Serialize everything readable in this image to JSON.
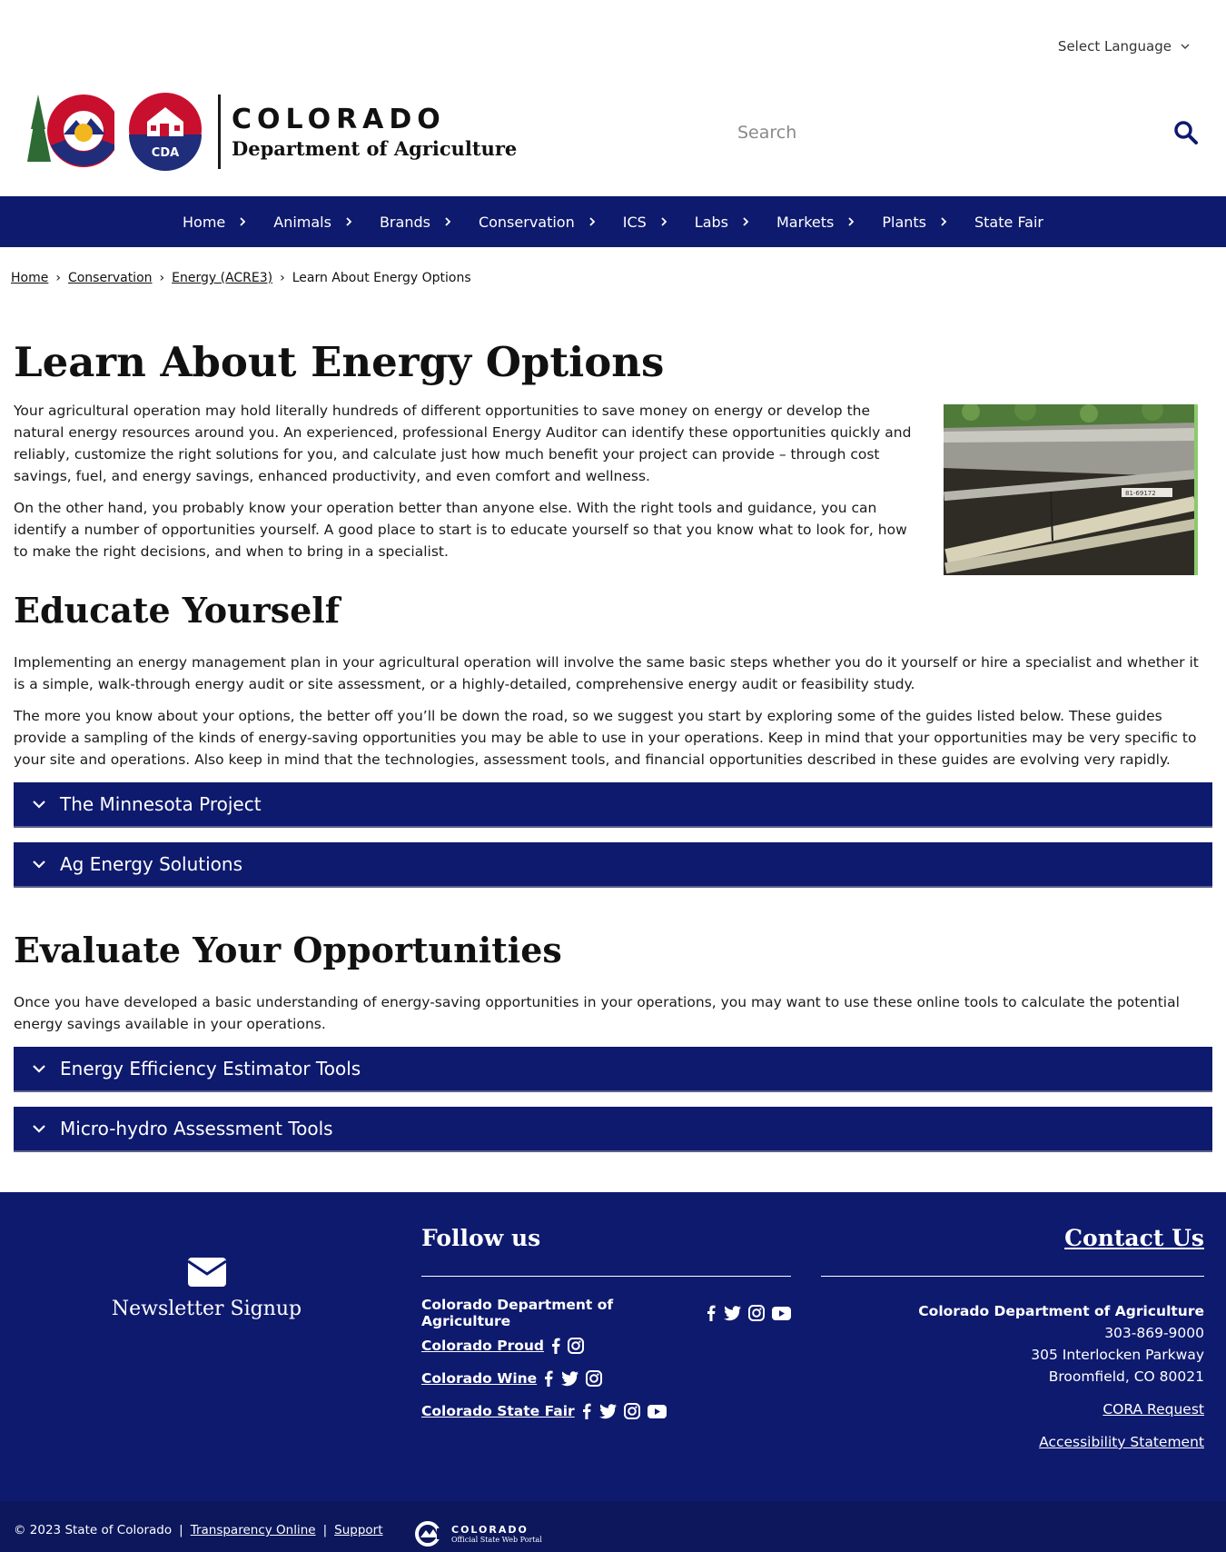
{
  "language_select": {
    "label": "Select Language"
  },
  "logo": {
    "badge_text": "CDA",
    "title": "COLORADO",
    "subtitle": "Department of Agriculture"
  },
  "search": {
    "placeholder": "Search"
  },
  "nav": {
    "items": [
      {
        "label": "Home"
      },
      {
        "label": "Animals"
      },
      {
        "label": "Brands"
      },
      {
        "label": "Conservation"
      },
      {
        "label": "ICS"
      },
      {
        "label": "Labs"
      },
      {
        "label": "Markets"
      },
      {
        "label": "Plants"
      },
      {
        "label": "State Fair"
      }
    ]
  },
  "breadcrumb": {
    "items": [
      {
        "label": "Home"
      },
      {
        "label": "Conservation"
      },
      {
        "label": "Energy (ACRE3)"
      }
    ],
    "current": "Learn About Energy Options"
  },
  "main": {
    "title": "Learn About Energy Options",
    "intro": [
      "Your agricultural operation may hold literally hundreds of different opportunities to save money on energy or develop the natural energy resources around you. An experienced, professional Energy Auditor can identify these opportunities quickly and reliably, customize the right solutions for you, and calculate just how much benefit your project can provide – through cost savings, fuel, and energy savings, enhanced productivity, and even comfort and wellness.",
      "On the other hand, you probably know your operation better than anyone else. With the right tools and guidance, you can identify a number of opportunities yourself. A good place to start is to educate yourself so that you know what to look for, how to make the right decisions, and when to bring in a specialist."
    ],
    "photo_label": "81-69172",
    "educate": {
      "heading": "Educate Yourself",
      "paragraphs": [
        "Implementing an energy management plan in your agricultural operation will involve the same basic steps whether you do it yourself or hire a specialist and whether it is a simple, walk-through energy audit or site assessment, or a highly-detailed, comprehensive energy audit or feasibility study.",
        "The more you know about your options, the better off you’ll be down the road, so we suggest you start by exploring some of the guides listed below. These guides provide a sampling of the kinds of energy-saving opportunities you may be able to use in your operations. Keep in mind that your opportunities may be very specific to your site and operations. Also keep in mind that the technologies, assessment tools, and financial opportunities described in these guides are evolving very rapidly."
      ],
      "accordions": [
        {
          "label": "The Minnesota Project"
        },
        {
          "label": "Ag Energy Solutions"
        }
      ]
    },
    "evaluate": {
      "heading": "Evaluate Your Opportunities",
      "paragraph": "Once you have developed a basic understanding of energy-saving opportunities in your operations, you may want to use these online tools to calculate the potential energy savings available in your operations.",
      "accordions": [
        {
          "label": "Energy Efficiency Estimator Tools"
        },
        {
          "label": "Micro-hydro Assessment Tools"
        }
      ]
    }
  },
  "footer": {
    "newsletter": {
      "label": "Newsletter Signup",
      "icon": "envelope-icon"
    },
    "follow": {
      "heading": "Follow us",
      "rows": [
        {
          "name": "Colorado Department of Agriculture",
          "icons": [
            "facebook-icon",
            "twitter-icon",
            "instagram-icon",
            "youtube-icon"
          ]
        },
        {
          "name": "Colorado Proud",
          "icons": [
            "facebook-icon",
            "instagram-icon"
          ]
        },
        {
          "name": "Colorado Wine",
          "icons": [
            "facebook-icon",
            "twitter-icon",
            "instagram-icon"
          ]
        },
        {
          "name": "Colorado State Fair",
          "icons": [
            "facebook-icon",
            "twitter-icon",
            "instagram-icon",
            "youtube-icon"
          ]
        }
      ]
    },
    "contact": {
      "heading": "Contact Us",
      "org": "Colorado Department of Agriculture",
      "phone": "303-869-9000",
      "address1": "305 Interlocken Parkway",
      "address2": "Broomfield, CO 80021",
      "cora": "CORA Request",
      "accessibility": "Accessibility Statement"
    },
    "legal": {
      "copyright": "© 2023 State of Colorado",
      "sep": "|",
      "transparency": "Transparency Online",
      "support": "Support",
      "portal_title": "COLORADO",
      "portal_sub": "Official State Web Portal"
    }
  },
  "colors": {
    "navy": "#0e1a6e",
    "footer_legal": "#0c175c",
    "logo_red": "#c8102e",
    "logo_blue": "#1f2d7a",
    "logo_gold": "#f2b71f",
    "logo_green": "#2e6b34"
  }
}
